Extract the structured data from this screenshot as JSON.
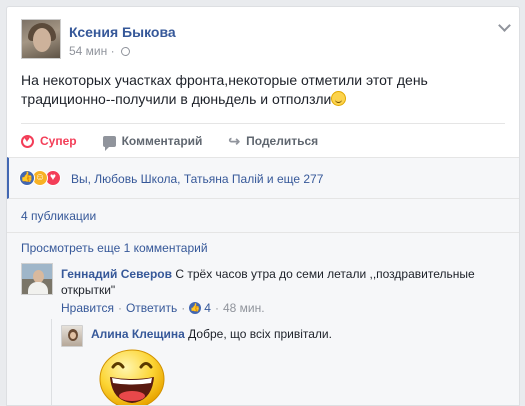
{
  "post": {
    "author": "Ксения Быкова",
    "time": "54 мин",
    "text": "На некоторых участках фронта,некоторые отметили этот день традиционно--получили в дюньдель и отползли"
  },
  "actions": {
    "like": "Супер",
    "comment": "Комментарий",
    "share": "Поделиться"
  },
  "reactions": {
    "summary": "Вы, Любовь Школа, Татьяна Палій и еще 277",
    "types": [
      "like-icon",
      "haha-icon",
      "love-icon"
    ]
  },
  "shares": "4 публикации",
  "comments": {
    "more": "Просмотреть еще 1 комментарий",
    "items": [
      {
        "author": "Геннадий Северов",
        "text": "С трёх часов утра до семи летали ,,поздравительные открытки\"",
        "like": "Нравится",
        "reply": "Ответить",
        "like_count": "4",
        "time": "48 мин."
      },
      {
        "author": "Алина Клещина",
        "text": "Добре, що всіх привітали."
      }
    ]
  },
  "colors": {
    "link": "#365899",
    "liked": "#f33e58",
    "accent": "#4267b2"
  }
}
